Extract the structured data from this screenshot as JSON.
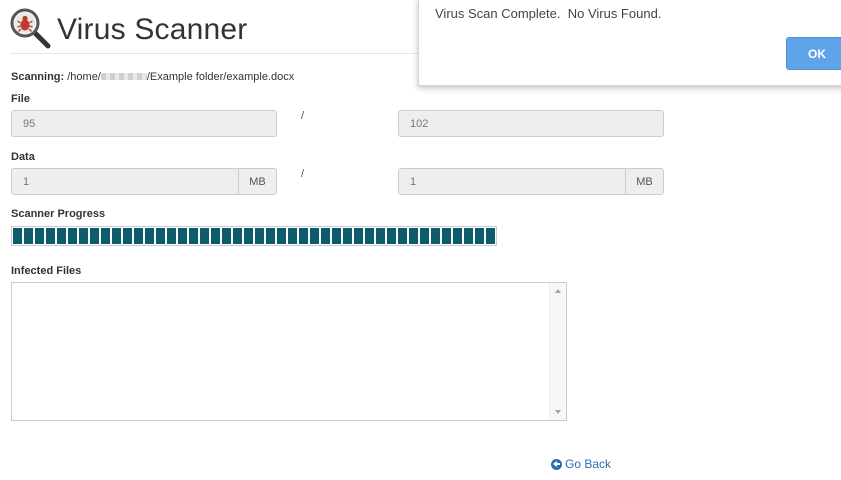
{
  "header": {
    "title": "Virus Scanner",
    "icon": "bug-magnifier-icon"
  },
  "scanning": {
    "label": "Scanning:",
    "path_prefix": "/home/",
    "path_suffix": "/Example folder/example.docx"
  },
  "file": {
    "label": "File",
    "scanned": "95",
    "separator": "/",
    "total": "102"
  },
  "data": {
    "label": "Data",
    "scanned": "1",
    "scanned_unit": "MB",
    "separator": "/",
    "total": "1",
    "total_unit": "MB"
  },
  "progress": {
    "label": "Scanner Progress",
    "fraction": 1.0,
    "color": "#0d5c6e"
  },
  "infected": {
    "label": "Infected Files",
    "value": ""
  },
  "go_back": {
    "label": "Go Back",
    "icon": "arrow-circle-left-icon"
  },
  "modal": {
    "message": "Virus Scan Complete.  No Virus Found.",
    "ok_label": "OK",
    "ok_color": "#5fa3e8"
  }
}
